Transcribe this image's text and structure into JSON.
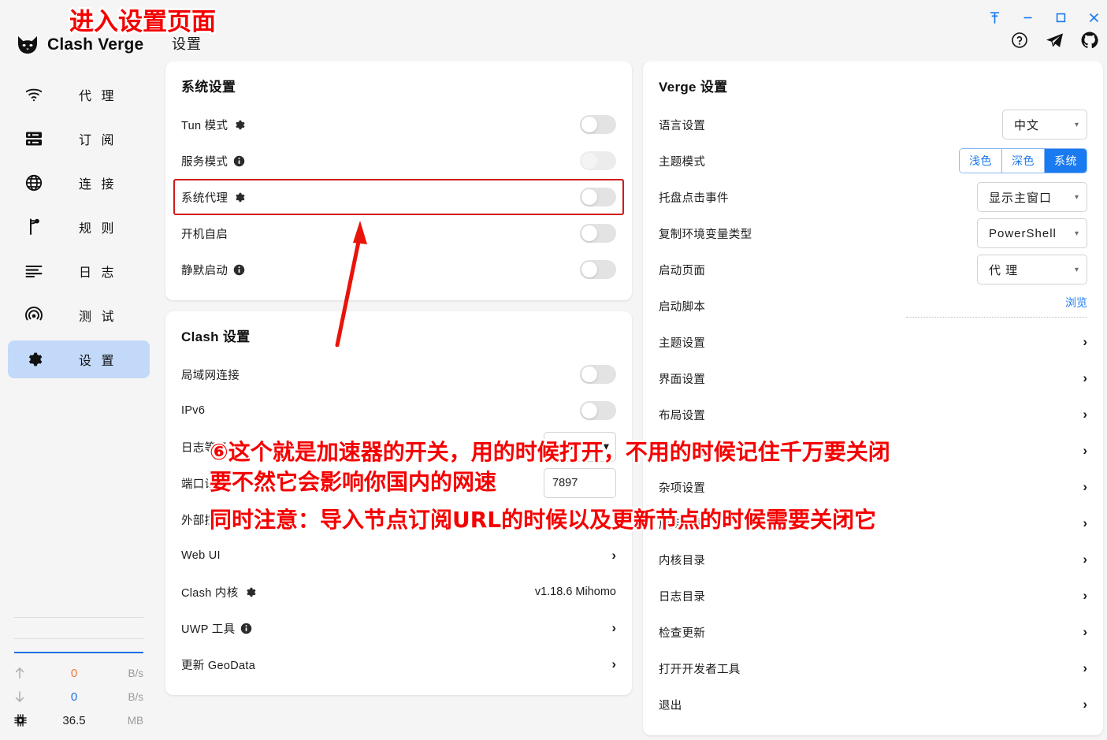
{
  "app": {
    "brand": "Clash Verge",
    "page_title": "设置",
    "logo_icon": "cat-logo-icon"
  },
  "titlebar": {
    "pin_icon": "pin-icon",
    "minimize_icon": "minimize-icon",
    "maximize_icon": "maximize-icon",
    "close_icon": "close-icon",
    "help_icon": "help-circle-icon",
    "telegram_icon": "telegram-icon",
    "github_icon": "github-icon"
  },
  "sidebar": {
    "items": [
      {
        "label": "代 理",
        "icon": "wifi-icon",
        "active": false
      },
      {
        "label": "订 阅",
        "icon": "server-icon",
        "active": false
      },
      {
        "label": "连 接",
        "icon": "globe-icon",
        "active": false
      },
      {
        "label": "规 则",
        "icon": "rules-branch-icon",
        "active": false
      },
      {
        "label": "日 志",
        "icon": "log-lines-icon",
        "active": false
      },
      {
        "label": "测 试",
        "icon": "radar-icon",
        "active": false
      },
      {
        "label": "设 置",
        "icon": "gear-icon",
        "active": true
      }
    ],
    "stats": {
      "upload": {
        "icon": "arrow-up-icon",
        "value": "0",
        "unit": "B/s"
      },
      "download": {
        "icon": "arrow-down-icon",
        "value": "0",
        "unit": "B/s"
      },
      "memory": {
        "icon": "chip-icon",
        "value": "36.5",
        "unit": "MB"
      }
    }
  },
  "system_settings": {
    "title": "系统设置",
    "rows": [
      {
        "label": "Tun 模式",
        "adornment": "gear-icon",
        "control": "toggle",
        "on": false,
        "highlight": false
      },
      {
        "label": "服务模式",
        "adornment": "info-icon",
        "control": "toggle",
        "on": false,
        "faded": true,
        "highlight": false
      },
      {
        "label": "系统代理",
        "adornment": "gear-icon",
        "control": "toggle",
        "on": false,
        "highlight": true
      },
      {
        "label": "开机自启",
        "adornment": "",
        "control": "toggle",
        "on": false,
        "highlight": false
      },
      {
        "label": "静默启动",
        "adornment": "info-icon",
        "control": "toggle",
        "on": false,
        "highlight": false
      }
    ]
  },
  "clash_settings": {
    "title": "Clash 设置",
    "rows": [
      {
        "label": "局域网连接",
        "adornment": "",
        "control": "toggle",
        "on": false
      },
      {
        "label": "IPv6",
        "adornment": "",
        "control": "toggle",
        "on": false
      },
      {
        "label": "日志等级",
        "adornment": "",
        "control": "select",
        "value": "Info"
      },
      {
        "label": "端口设置",
        "adornment": "",
        "control": "input",
        "value": "7897"
      },
      {
        "label": "外部控制",
        "adornment": "",
        "control": "input",
        "value": ""
      },
      {
        "label": "Web UI",
        "adornment": "",
        "control": "chevron"
      },
      {
        "label": "Clash 内核",
        "adornment": "gear-icon",
        "control": "value",
        "value": "v1.18.6 Mihomo"
      },
      {
        "label": "UWP 工具",
        "adornment": "info-icon",
        "control": "chevron"
      },
      {
        "label": "更新 GeoData",
        "adornment": "",
        "control": "chevron"
      }
    ]
  },
  "verge_settings": {
    "title": "Verge 设置",
    "rows": [
      {
        "label": "语言设置",
        "control": "select",
        "value": "中文",
        "width": "w-lang"
      },
      {
        "label": "主题模式",
        "control": "buttongroup",
        "options": [
          "浅色",
          "深色",
          "系统"
        ],
        "selected": "系统"
      },
      {
        "label": "托盘点击事件",
        "control": "select",
        "value": "显示主窗口",
        "width": "w-tray"
      },
      {
        "label": "复制环境变量类型",
        "control": "select",
        "value": "PowerShell",
        "width": "w-ps"
      },
      {
        "label": "启动页面",
        "control": "select",
        "value": "代 理",
        "width": "w-start"
      },
      {
        "label": "启动脚本",
        "control": "browse",
        "link": "浏览"
      },
      {
        "label": "主题设置",
        "control": "chevron"
      },
      {
        "label": "界面设置",
        "control": "chevron"
      },
      {
        "label": "布局设置",
        "control": "chevron"
      },
      {
        "label": "热键设置",
        "control": "chevron"
      },
      {
        "label": "杂项设置",
        "control": "chevron"
      },
      {
        "label": "应用目录",
        "control": "chevron"
      },
      {
        "label": "内核目录",
        "control": "chevron"
      },
      {
        "label": "日志目录",
        "control": "chevron"
      },
      {
        "label": "检查更新",
        "control": "chevron"
      },
      {
        "label": "打开开发者工具",
        "control": "chevron"
      },
      {
        "label": "退出",
        "control": "chevron"
      }
    ]
  },
  "annotations": {
    "title": "进入设置页面",
    "line1": "⑥这个就是加速器的开关，用的时候打开，不用的时候记住千万要关闭",
    "line2": "要不然它会影响你国内的网速",
    "line3": "同时注意：导入节点订阅URL的时候以及更新节点的时候需要关闭它",
    "color": "#f50000",
    "arrow_color": "#e8140a",
    "highlight_box_color": "#d11a1a"
  }
}
